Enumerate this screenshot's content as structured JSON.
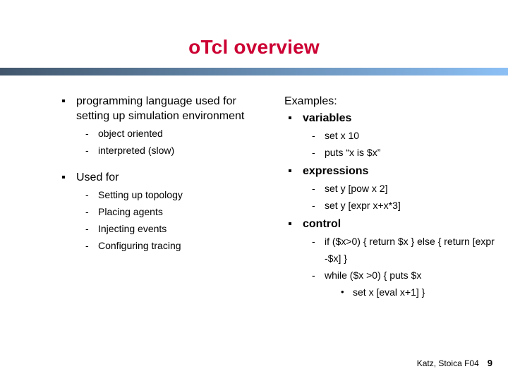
{
  "slide": {
    "title": "oTcl overview",
    "title_color": "#cc0033",
    "rule_gradient_from": "#41566b",
    "rule_gradient_to": "#8cc0f5"
  },
  "left_column": {
    "bullet1": {
      "text": "programming language used for setting up simulation environment",
      "sub": [
        {
          "dash": "-",
          "text": "object oriented"
        },
        {
          "dash": "-",
          "text": "interpreted (slow)"
        }
      ]
    },
    "bullet2": {
      "text": "Used for",
      "sub": [
        {
          "dash": "-",
          "text": "Setting up topology"
        },
        {
          "dash": "-",
          "text": "Placing agents"
        },
        {
          "dash": "-",
          "text": "Injecting events"
        },
        {
          "dash": "-",
          "text": "Configuring tracing"
        }
      ]
    }
  },
  "right_column": {
    "heading": "Examples:",
    "groups": [
      {
        "label": "variables",
        "sub": [
          {
            "dash": "-",
            "text": "set x 10"
          },
          {
            "dash": "-",
            "text": "puts “x is $x”"
          }
        ]
      },
      {
        "label": "expressions",
        "sub": [
          {
            "dash": "-",
            "text": "set y [pow x 2]"
          },
          {
            "dash": "-",
            "text": "set y [expr x+x*3]"
          }
        ]
      },
      {
        "label": "control",
        "sub": [
          {
            "dash": "-",
            "text": "if ($x>0) { return $x } else { return [expr -$x] }"
          },
          {
            "dash": "-",
            "text": "while ($x >0) { puts $x"
          }
        ],
        "sub3": [
          {
            "dot": "•",
            "text": "set x [eval x+1] }"
          }
        ]
      }
    ]
  },
  "footer": {
    "credit": "Katz, Stoica F04",
    "page_number": "9"
  }
}
